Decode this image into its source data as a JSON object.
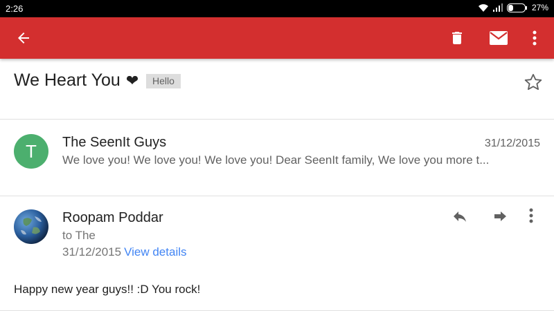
{
  "status_bar": {
    "time": "2:26",
    "battery": "27%",
    "icons": [
      "wifi-icon",
      "signal-icon",
      "battery-icon"
    ]
  },
  "app_bar": {
    "background_color": "#d32f2f",
    "icons": [
      "back-arrow-icon",
      "trash-icon",
      "mail-icon",
      "more-vert-icon"
    ]
  },
  "thread": {
    "subject": "We Heart You",
    "heart_glyph": "❤",
    "label": "Hello"
  },
  "messages": [
    {
      "avatar_letter": "T",
      "avatar_color": "#4caf6e",
      "sender": "The SeenIt Guys",
      "date": "31/12/2015",
      "snippet": "We love you! We love you! We love you! Dear SeenIt family, We love you more t..."
    },
    {
      "avatar": "earth-avatar",
      "sender": "Roopam Poddar",
      "to": "to The",
      "date": "31/12/2015",
      "view_details": "View details",
      "body": "Happy new year guys!! :D You rock!",
      "link_color": "#4285f4"
    }
  ]
}
